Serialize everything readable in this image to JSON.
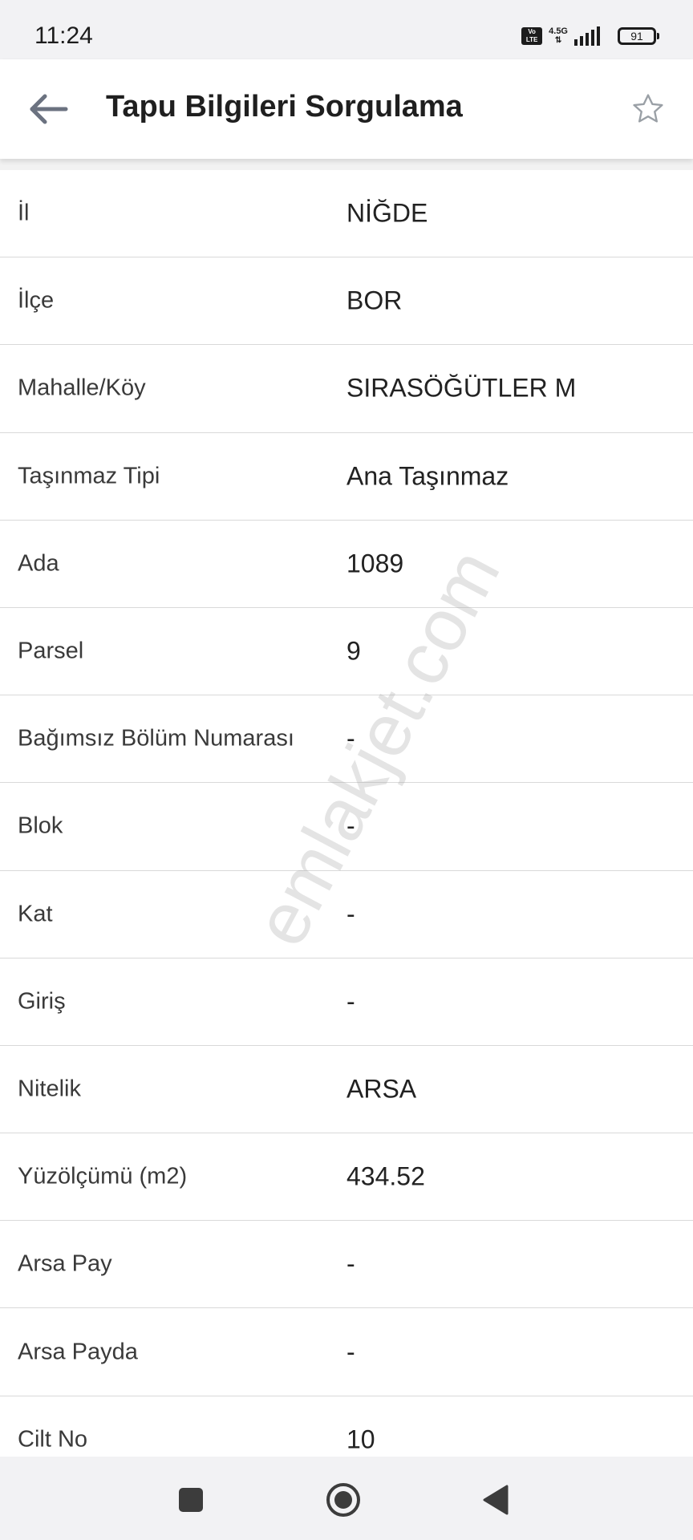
{
  "status_bar": {
    "time": "11:24",
    "volte_top": "Vo",
    "volte_bottom": "LTE",
    "network": "4.5G",
    "battery": "91"
  },
  "header": {
    "title": "Tapu Bilgileri Sorgulama",
    "back_icon": "arrow-left-icon",
    "favorite_icon": "star-outline-icon"
  },
  "watermark": "emlakjet.com",
  "rows": [
    {
      "label": "İl",
      "value": "NİĞDE"
    },
    {
      "label": "İlçe",
      "value": "BOR"
    },
    {
      "label": "Mahalle/Köy",
      "value": "SIRASÖĞÜTLER M"
    },
    {
      "label": "Taşınmaz Tipi",
      "value": "Ana Taşınmaz"
    },
    {
      "label": "Ada",
      "value": "1089"
    },
    {
      "label": "Parsel",
      "value": "9"
    },
    {
      "label": "Bağımsız Bölüm Numarası",
      "value": "-"
    },
    {
      "label": "Blok",
      "value": "-"
    },
    {
      "label": "Kat",
      "value": "-"
    },
    {
      "label": "Giriş",
      "value": "-"
    },
    {
      "label": "Nitelik",
      "value": "ARSA"
    },
    {
      "label": "Yüzölçümü (m2)",
      "value": "434.52"
    },
    {
      "label": "Arsa Pay",
      "value": "-"
    },
    {
      "label": "Arsa Payda",
      "value": "-"
    },
    {
      "label": "Cilt No",
      "value": "10"
    }
  ],
  "nav_bar": {
    "recents_icon": "square-icon",
    "home_icon": "circle-home-icon",
    "back_icon": "triangle-back-icon"
  }
}
